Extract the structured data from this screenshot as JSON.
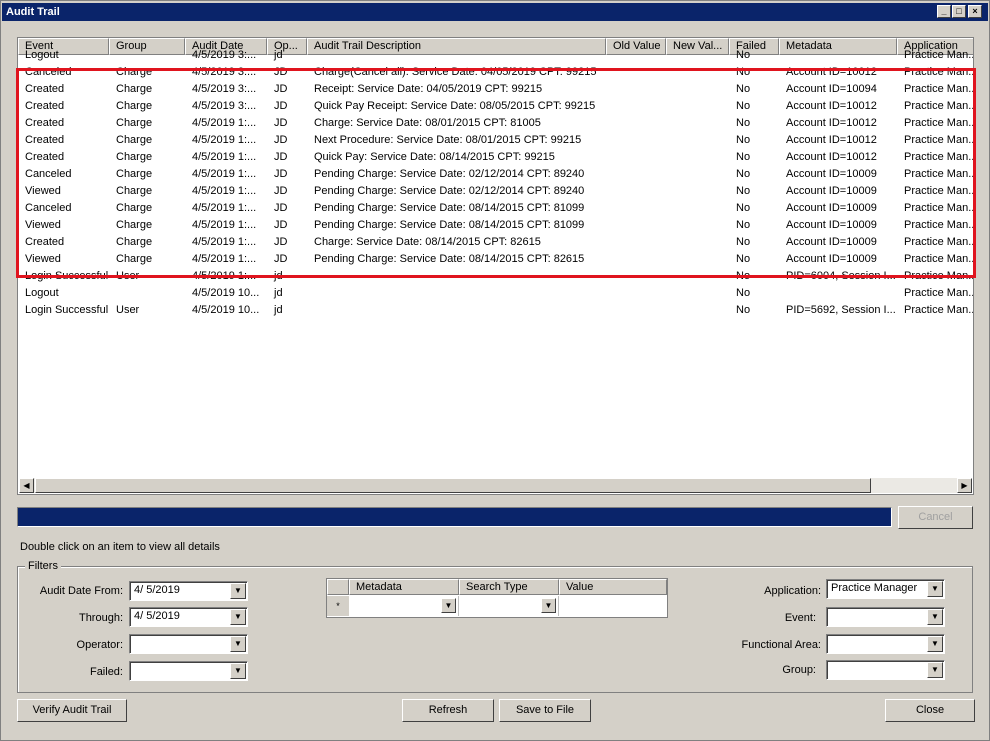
{
  "window": {
    "title": "Audit Trail"
  },
  "columns": [
    "Event",
    "Group",
    "Audit Date",
    "Op...",
    "Audit Trail Description",
    "Old Value",
    "New Val...",
    "Failed",
    "Metadata",
    "Application"
  ],
  "rows": [
    [
      "Logout",
      "",
      "4/5/2019 3:...",
      "jd",
      "",
      "",
      "",
      "No",
      "",
      "Practice Man..."
    ],
    [
      "Canceled",
      "Charge",
      "4/5/2019 3:...",
      "JD",
      "Charge(Cancel all): Service Date: 04/05/2019 CPT: 99215",
      "",
      "",
      "No",
      "Account ID=10012",
      "Practice Man..."
    ],
    [
      "Created",
      "Charge",
      "4/5/2019 3:...",
      "JD",
      "Receipt: Service Date: 04/05/2019 CPT: 99215",
      "",
      "",
      "No",
      "Account ID=10094",
      "Practice Man..."
    ],
    [
      "Created",
      "Charge",
      "4/5/2019 3:...",
      "JD",
      "Quick Pay Receipt: Service Date: 08/05/2015 CPT: 99215",
      "",
      "",
      "No",
      "Account ID=10012",
      "Practice Man..."
    ],
    [
      "Created",
      "Charge",
      "4/5/2019 1:...",
      "JD",
      "Charge: Service Date: 08/01/2015 CPT: 81005",
      "",
      "",
      "No",
      "Account ID=10012",
      "Practice Man..."
    ],
    [
      "Created",
      "Charge",
      "4/5/2019 1:...",
      "JD",
      "Next Procedure: Service Date: 08/01/2015 CPT: 99215",
      "",
      "",
      "No",
      "Account ID=10012",
      "Practice Man..."
    ],
    [
      "Created",
      "Charge",
      "4/5/2019 1:...",
      "JD",
      "Quick Pay: Service Date: 08/14/2015 CPT: 99215",
      "",
      "",
      "No",
      "Account ID=10012",
      "Practice Man..."
    ],
    [
      "Canceled",
      "Charge",
      "4/5/2019 1:...",
      "JD",
      "Pending Charge: Service Date: 02/12/2014 CPT: 89240",
      "",
      "",
      "No",
      "Account ID=10009",
      "Practice Man..."
    ],
    [
      "Viewed",
      "Charge",
      "4/5/2019 1:...",
      "JD",
      "Pending Charge: Service Date: 02/12/2014 CPT: 89240",
      "",
      "",
      "No",
      "Account ID=10009",
      "Practice Man..."
    ],
    [
      "Canceled",
      "Charge",
      "4/5/2019 1:...",
      "JD",
      "Pending Charge: Service Date: 08/14/2015 CPT: 81099",
      "",
      "",
      "No",
      "Account ID=10009",
      "Practice Man..."
    ],
    [
      "Viewed",
      "Charge",
      "4/5/2019 1:...",
      "JD",
      "Pending Charge: Service Date: 08/14/2015 CPT: 81099",
      "",
      "",
      "No",
      "Account ID=10009",
      "Practice Man..."
    ],
    [
      "Created",
      "Charge",
      "4/5/2019 1:...",
      "JD",
      "Charge: Service Date: 08/14/2015 CPT: 82615",
      "",
      "",
      "No",
      "Account ID=10009",
      "Practice Man..."
    ],
    [
      "Viewed",
      "Charge",
      "4/5/2019 1:...",
      "JD",
      "Pending Charge: Service Date: 08/14/2015 CPT: 82615",
      "",
      "",
      "No",
      "Account ID=10009",
      "Practice Man..."
    ],
    [
      "Login Successful",
      "User",
      "4/5/2019 1:...",
      "jd",
      "",
      "",
      "",
      "No",
      "PID=6004, Session I...",
      "Practice Man..."
    ],
    [
      "Logout",
      "",
      "4/5/2019 10...",
      "jd",
      "",
      "",
      "",
      "No",
      "",
      "Practice Man..."
    ],
    [
      "Login Successful",
      "User",
      "4/5/2019 10...",
      "jd",
      "",
      "",
      "",
      "No",
      "PID=5692, Session I...",
      "Practice Man..."
    ]
  ],
  "cancel_label": "Cancel",
  "hint": "Double click on an item to view all details",
  "filters": {
    "legend": "Filters",
    "audit_date_from_label": "Audit Date From:",
    "audit_date_from": "4/  5/2019",
    "through_label": "Through:",
    "through": "4/  5/2019",
    "operator_label": "Operator:",
    "failed_label": "Failed:",
    "metadata_headers": [
      "Metadata",
      "Search Type",
      "Value"
    ],
    "new_row_marker": "*",
    "application_label": "Application:",
    "application": "Practice Manager",
    "event_label": "Event:",
    "functional_area_label": "Functional Area:",
    "group_label": "Group:"
  },
  "buttons": {
    "verify": "Verify Audit Trail",
    "refresh": "Refresh",
    "save": "Save to File",
    "close": "Close"
  },
  "icons": {
    "minimize": "_",
    "maximize": "□",
    "close": "×",
    "down_arrow": "▼",
    "left_arrow": "◀",
    "right_arrow": "▶"
  },
  "colors": {
    "title_bar": "#0a246a",
    "highlight": "#e0141e",
    "progress": "#0a246a"
  }
}
